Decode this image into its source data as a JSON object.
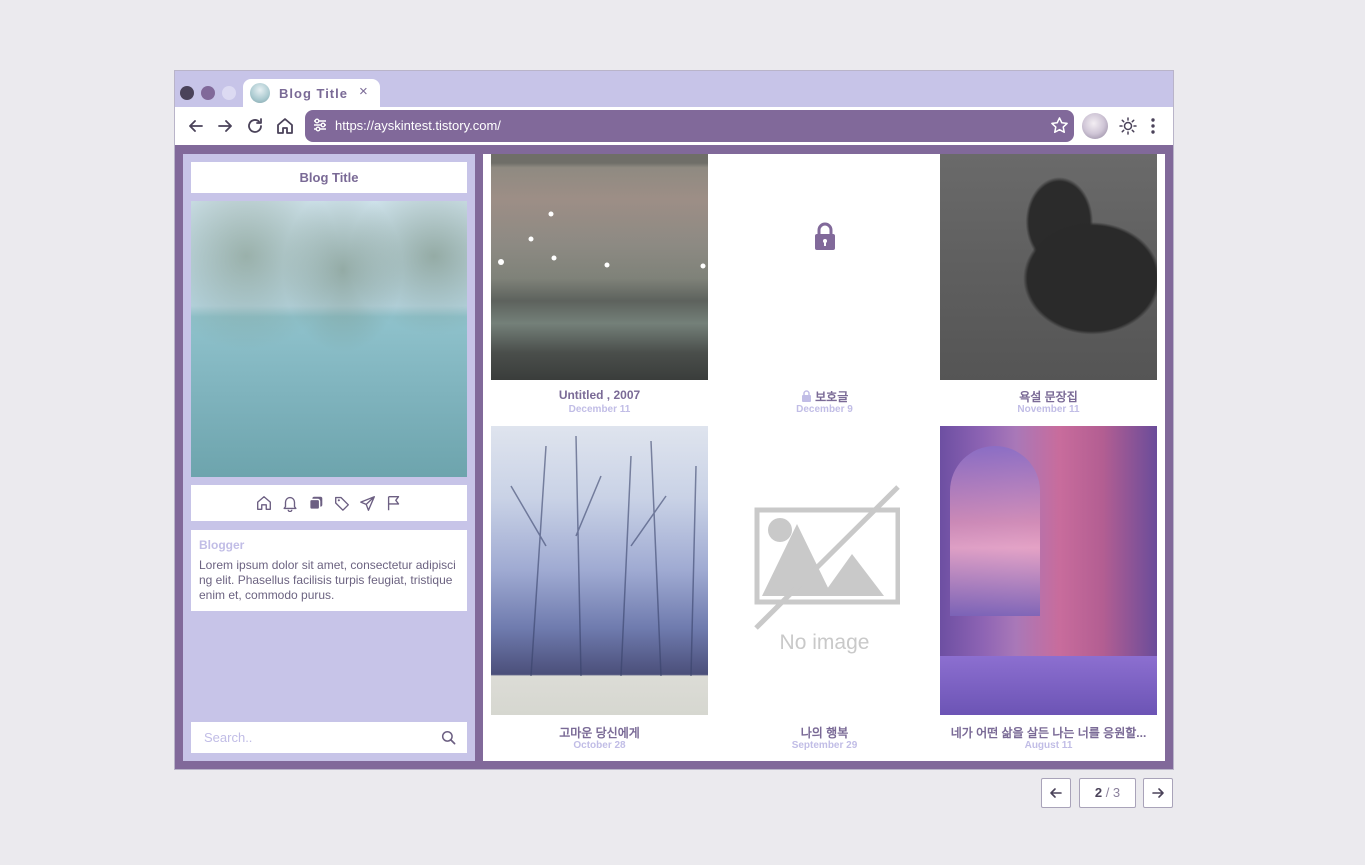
{
  "browser": {
    "tab_title": "Blog Title",
    "tab_close": "×",
    "url": "https://ayskintest.tistory.com/"
  },
  "colors": {
    "accent": "#81699a",
    "accent_light": "#c7c4e8",
    "text": "#7a6a96",
    "muted": "#c1bde6"
  },
  "sidebar": {
    "blog_title": "Blog Title",
    "icons": [
      "home-icon",
      "bell-icon",
      "copy-icon",
      "tag-icon",
      "send-icon",
      "flag-icon"
    ],
    "profile": {
      "name": "Blogger",
      "description": "Lorem ipsum dolor sit amet, consectetur adipiscing elit. Phasellus facilisis turpis feugiat, tristique enim et, commodo purus."
    },
    "search": {
      "placeholder": "Search.."
    }
  },
  "posts": [
    {
      "title": "Untitled , 2007",
      "date": "December 11"
    },
    {
      "title": "보호글",
      "date": "December 9",
      "locked": true
    },
    {
      "title": "욕설 문장집",
      "date": "November 11"
    },
    {
      "title": "고마운 당신에게",
      "date": "October 28"
    },
    {
      "title": "나의 행복",
      "date": "September 29",
      "no_image_text": "No image"
    },
    {
      "title": "네가 어떤 삶을 살든 나는 너를 응원할...",
      "date": "August 11"
    }
  ],
  "pagination": {
    "current": "2",
    "separator": " / ",
    "total": "3"
  }
}
